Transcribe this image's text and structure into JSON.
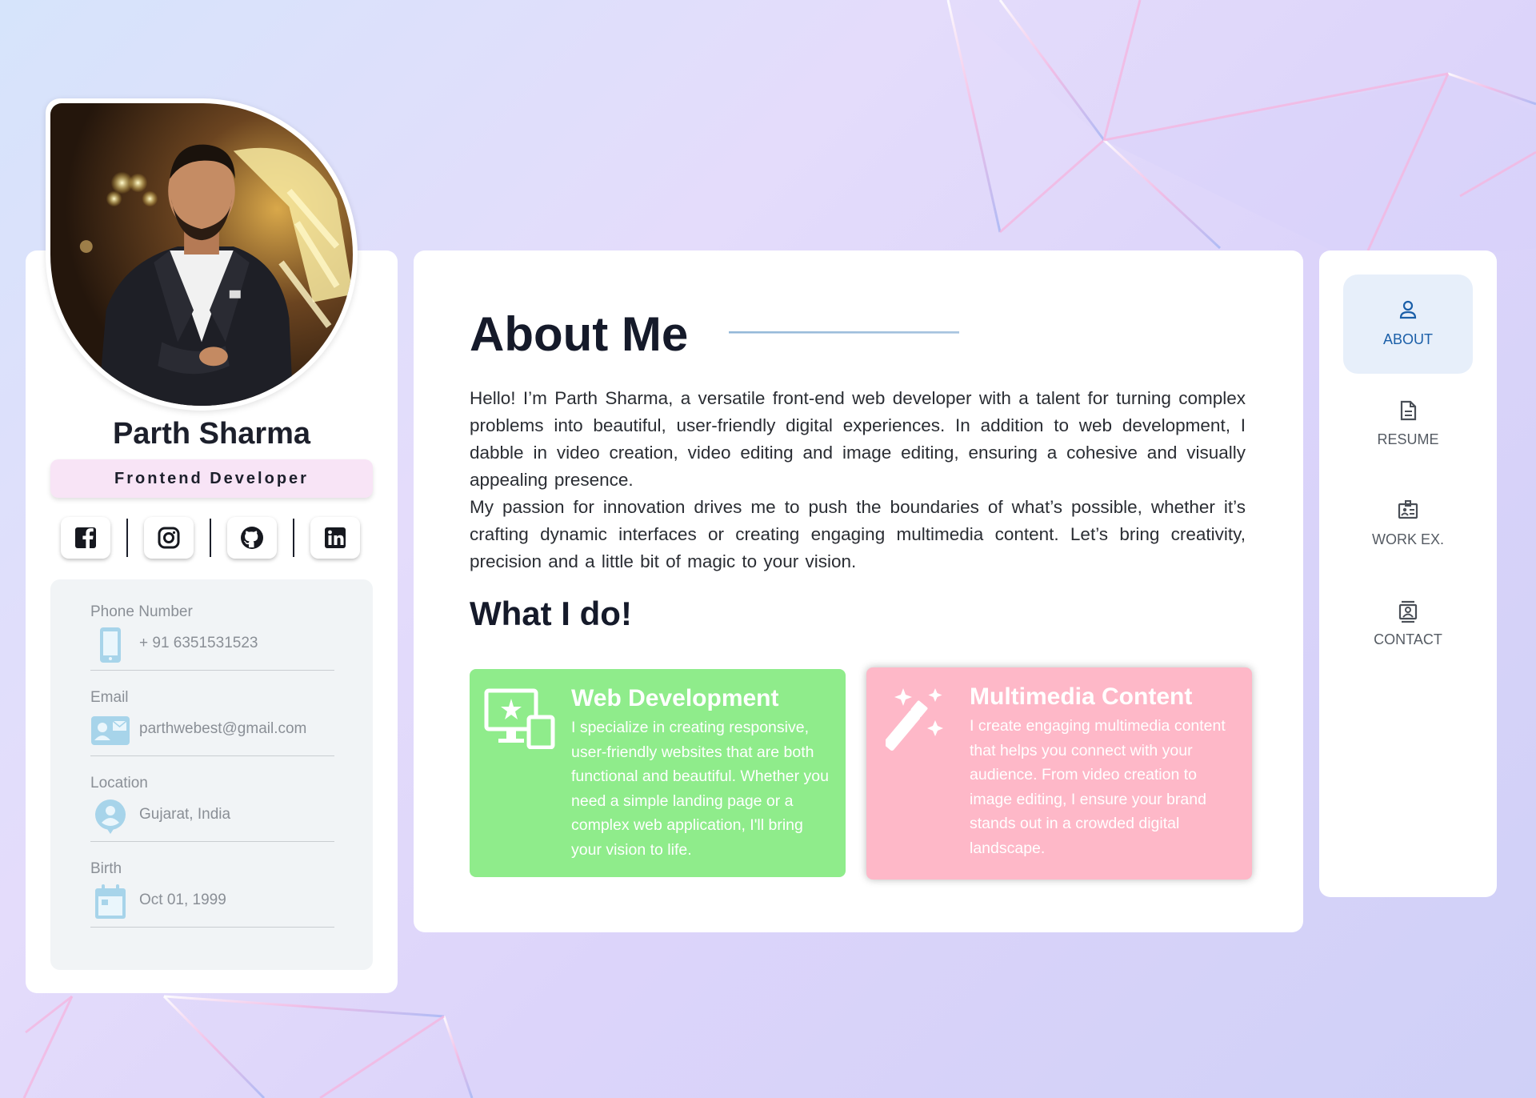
{
  "profile": {
    "name": "Parth Sharma",
    "role": "Frontend Developer",
    "socials": [
      "facebook-icon",
      "instagram-icon",
      "github-icon",
      "linkedin-icon"
    ],
    "contacts": [
      {
        "label": "Phone Number",
        "value": "+ 91 6351531523",
        "icon": "phone-icon"
      },
      {
        "label": "Email",
        "value": "parthwebest@gmail.com",
        "icon": "email-icon"
      },
      {
        "label": "Location",
        "value": "Gujarat, India",
        "icon": "location-icon"
      },
      {
        "label": "Birth",
        "value": "Oct 01, 1999",
        "icon": "calendar-icon"
      }
    ]
  },
  "about": {
    "title": "About Me",
    "bio_p1": "Hello! I’m Parth Sharma, a versatile front-end web developer with a talent for turning complex problems into beautiful, user-friendly digital experiences. In addition to web development, I dabble in video creation, video editing and image editing, ensuring a cohesive and visually appealing presence.",
    "bio_p2": "My passion for innovation drives me to push the boundaries of what’s possible, whether it’s crafting dynamic interfaces or creating engaging multimedia content. Let’s bring creativity, precision and a little bit of magic to your vision.",
    "whatido_title": "What I do!",
    "services": [
      {
        "title": "Web Development",
        "text": "I specialize in creating responsive, user-friendly websites that are both functional and beautiful. Whether you need a simple landing page or a complex web application, I'll bring your vision to life.",
        "color": "#8fec8b",
        "icon": "web-development-icon"
      },
      {
        "title": "Multimedia Content",
        "text": "I create engaging multimedia content that helps you connect with your audience. From video creation to image editing, I ensure your brand stands out in a crowded digital landscape.",
        "color": "#feb8c8",
        "icon": "magic-wand-icon"
      }
    ]
  },
  "nav": {
    "items": [
      {
        "label": "ABOUT",
        "icon": "user-icon",
        "active": true
      },
      {
        "label": "RESUME",
        "icon": "document-icon",
        "active": false
      },
      {
        "label": "WORK EX.",
        "icon": "briefcase-badge-icon",
        "active": false
      },
      {
        "label": "CONTACT",
        "icon": "contact-card-icon",
        "active": false
      }
    ],
    "accent": "#1b5fa8"
  },
  "theme_toggle_icon": "moon-icon"
}
